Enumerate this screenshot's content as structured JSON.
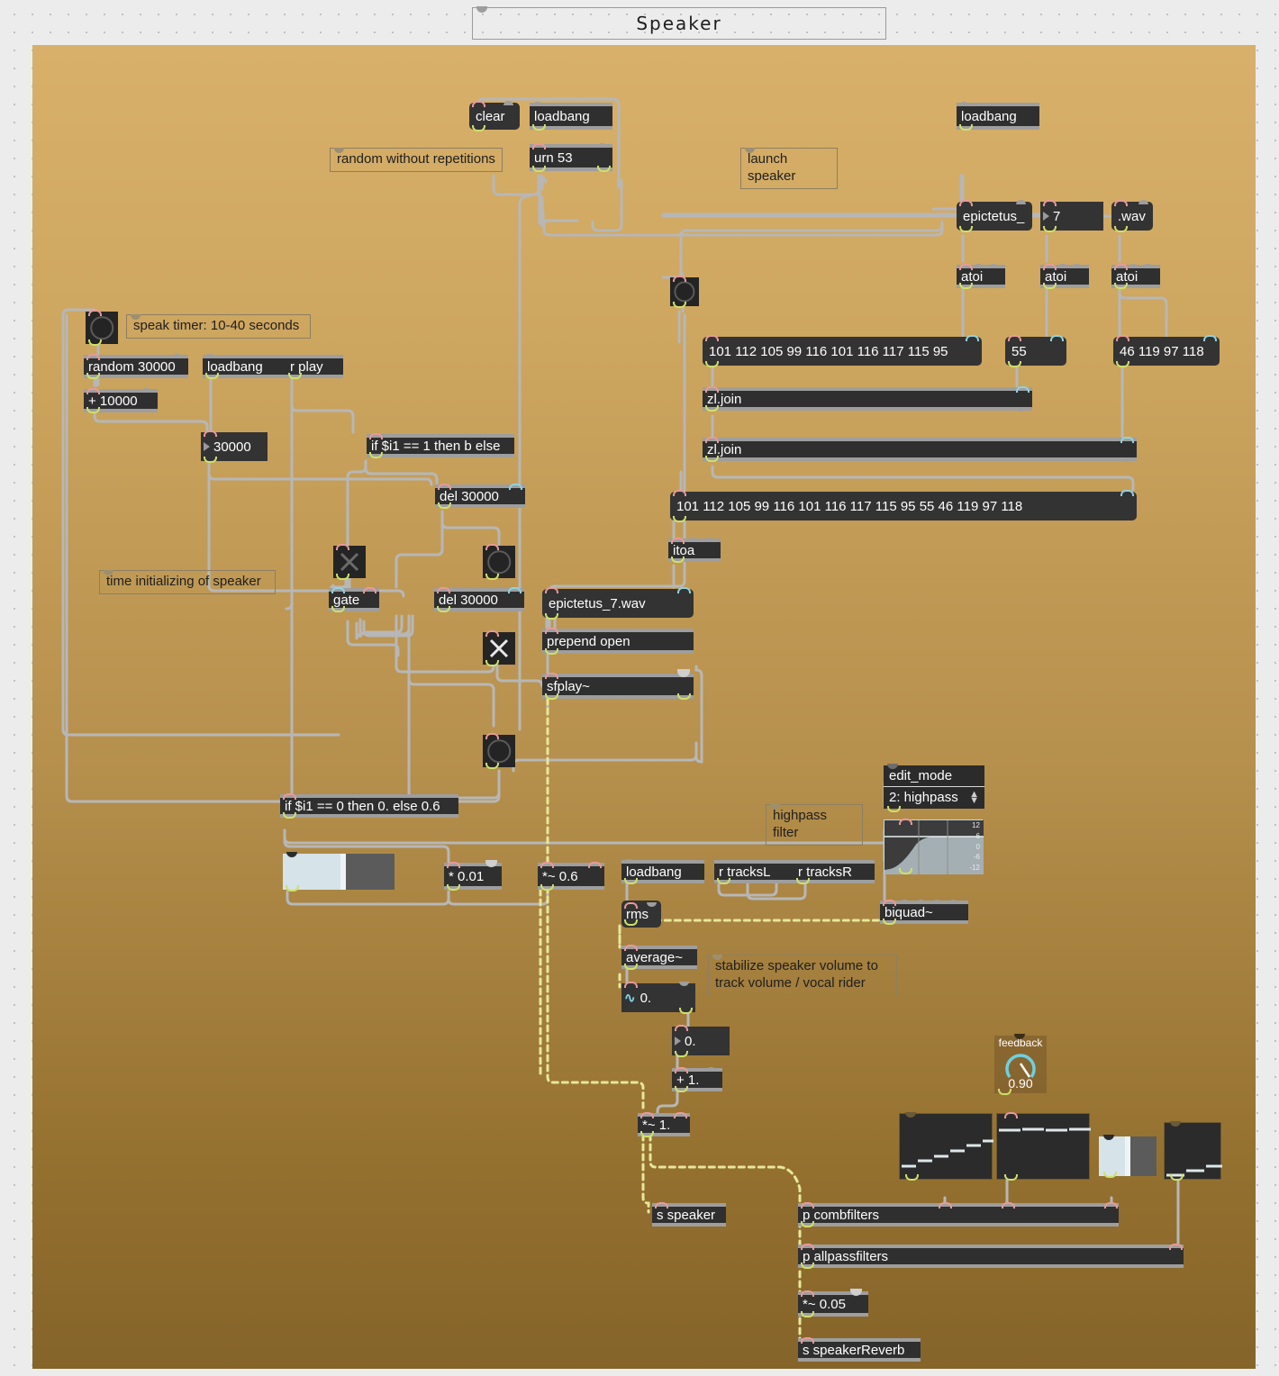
{
  "window": {
    "title": "Speaker"
  },
  "comments": {
    "random_no_rep": "random without repetitions",
    "launch_speaker": "launch speaker",
    "speak_timer": "speak timer: 10-40 seconds",
    "time_init": "time initializing of speaker",
    "highpass": "highpass filter",
    "stabilize": "stabilize speaker volume to track volume / vocal rider"
  },
  "objects": {
    "clear": "clear",
    "loadbang1": "loadbang",
    "urn53": "urn 53",
    "loadbang2": "loadbang",
    "epictetus_msg": "epictetus_",
    "wav_msg": ".wav",
    "atoi1": "atoi",
    "atoi2": "atoi",
    "atoi3": "atoi",
    "msg_epictetus_codes": "101 112 105 99 116 101 116 117 115 95",
    "msg_55": "55",
    "msg_wav_codes": "46 119 97 118",
    "zljoin1": "zl.join",
    "zljoin2": "zl.join",
    "msg_full_codes": "101 112 105 99 116 101 116 117 115 95 55 46 119 97 118",
    "itoa": "itoa",
    "msg_filename": "epictetus_7.wav",
    "prepend_open": "prepend open",
    "sfplay": "sfplay~",
    "random30000": "random 30000",
    "loadbang3": "loadbang",
    "rplay": "r play",
    "plus10000": "+ 10000",
    "if_b_else": "if $i1 == 1 then b else",
    "del1": "del 30000",
    "gate": "gate",
    "del2": "del 30000",
    "if_zero": "if $i1 == 0 then 0. else 0.6",
    "times001": "* 0.01",
    "timessig06": "*~ 0.6",
    "loadbang4": "loadbang",
    "rms": "rms",
    "r_tracksL": "r tracksL",
    "r_tracksR": "r tracksR",
    "biquad": "biquad~",
    "average": "average~",
    "plus1": "+ 1.",
    "timessig1": "*~ 1.",
    "s_speaker": "s speaker",
    "p_combfilters": "p combfilters",
    "p_allpassfilters": "p allpassfilters",
    "timessig005": "*~ 0.05",
    "s_speakerReverb": "s speakerReverb"
  },
  "values": {
    "number_7": "7",
    "number_30000": "30000",
    "scope_value": "0.",
    "number_zero": "0.",
    "feedback_label": "feedback",
    "feedback_value": "0.90",
    "edit_mode_title": "edit_mode",
    "edit_mode_value": "2: highpass",
    "filtergraph_axis": [
      "12",
      "6",
      "0",
      "-6",
      "-12"
    ]
  },
  "colors": {
    "patch_bg_top": "#d8b06a",
    "patch_bg_bottom": "#85642a",
    "object_bg": "#2f2f2f",
    "object_border": "#9e9e9e",
    "wire_signal": "#e6e79a",
    "wire_control": "#b5b5b5",
    "inlet_hot": "#e79a9a",
    "inlet_cold": "#8fd3e0",
    "outlet": "#cfe06a",
    "dial_accent": "#6fcfe0"
  }
}
